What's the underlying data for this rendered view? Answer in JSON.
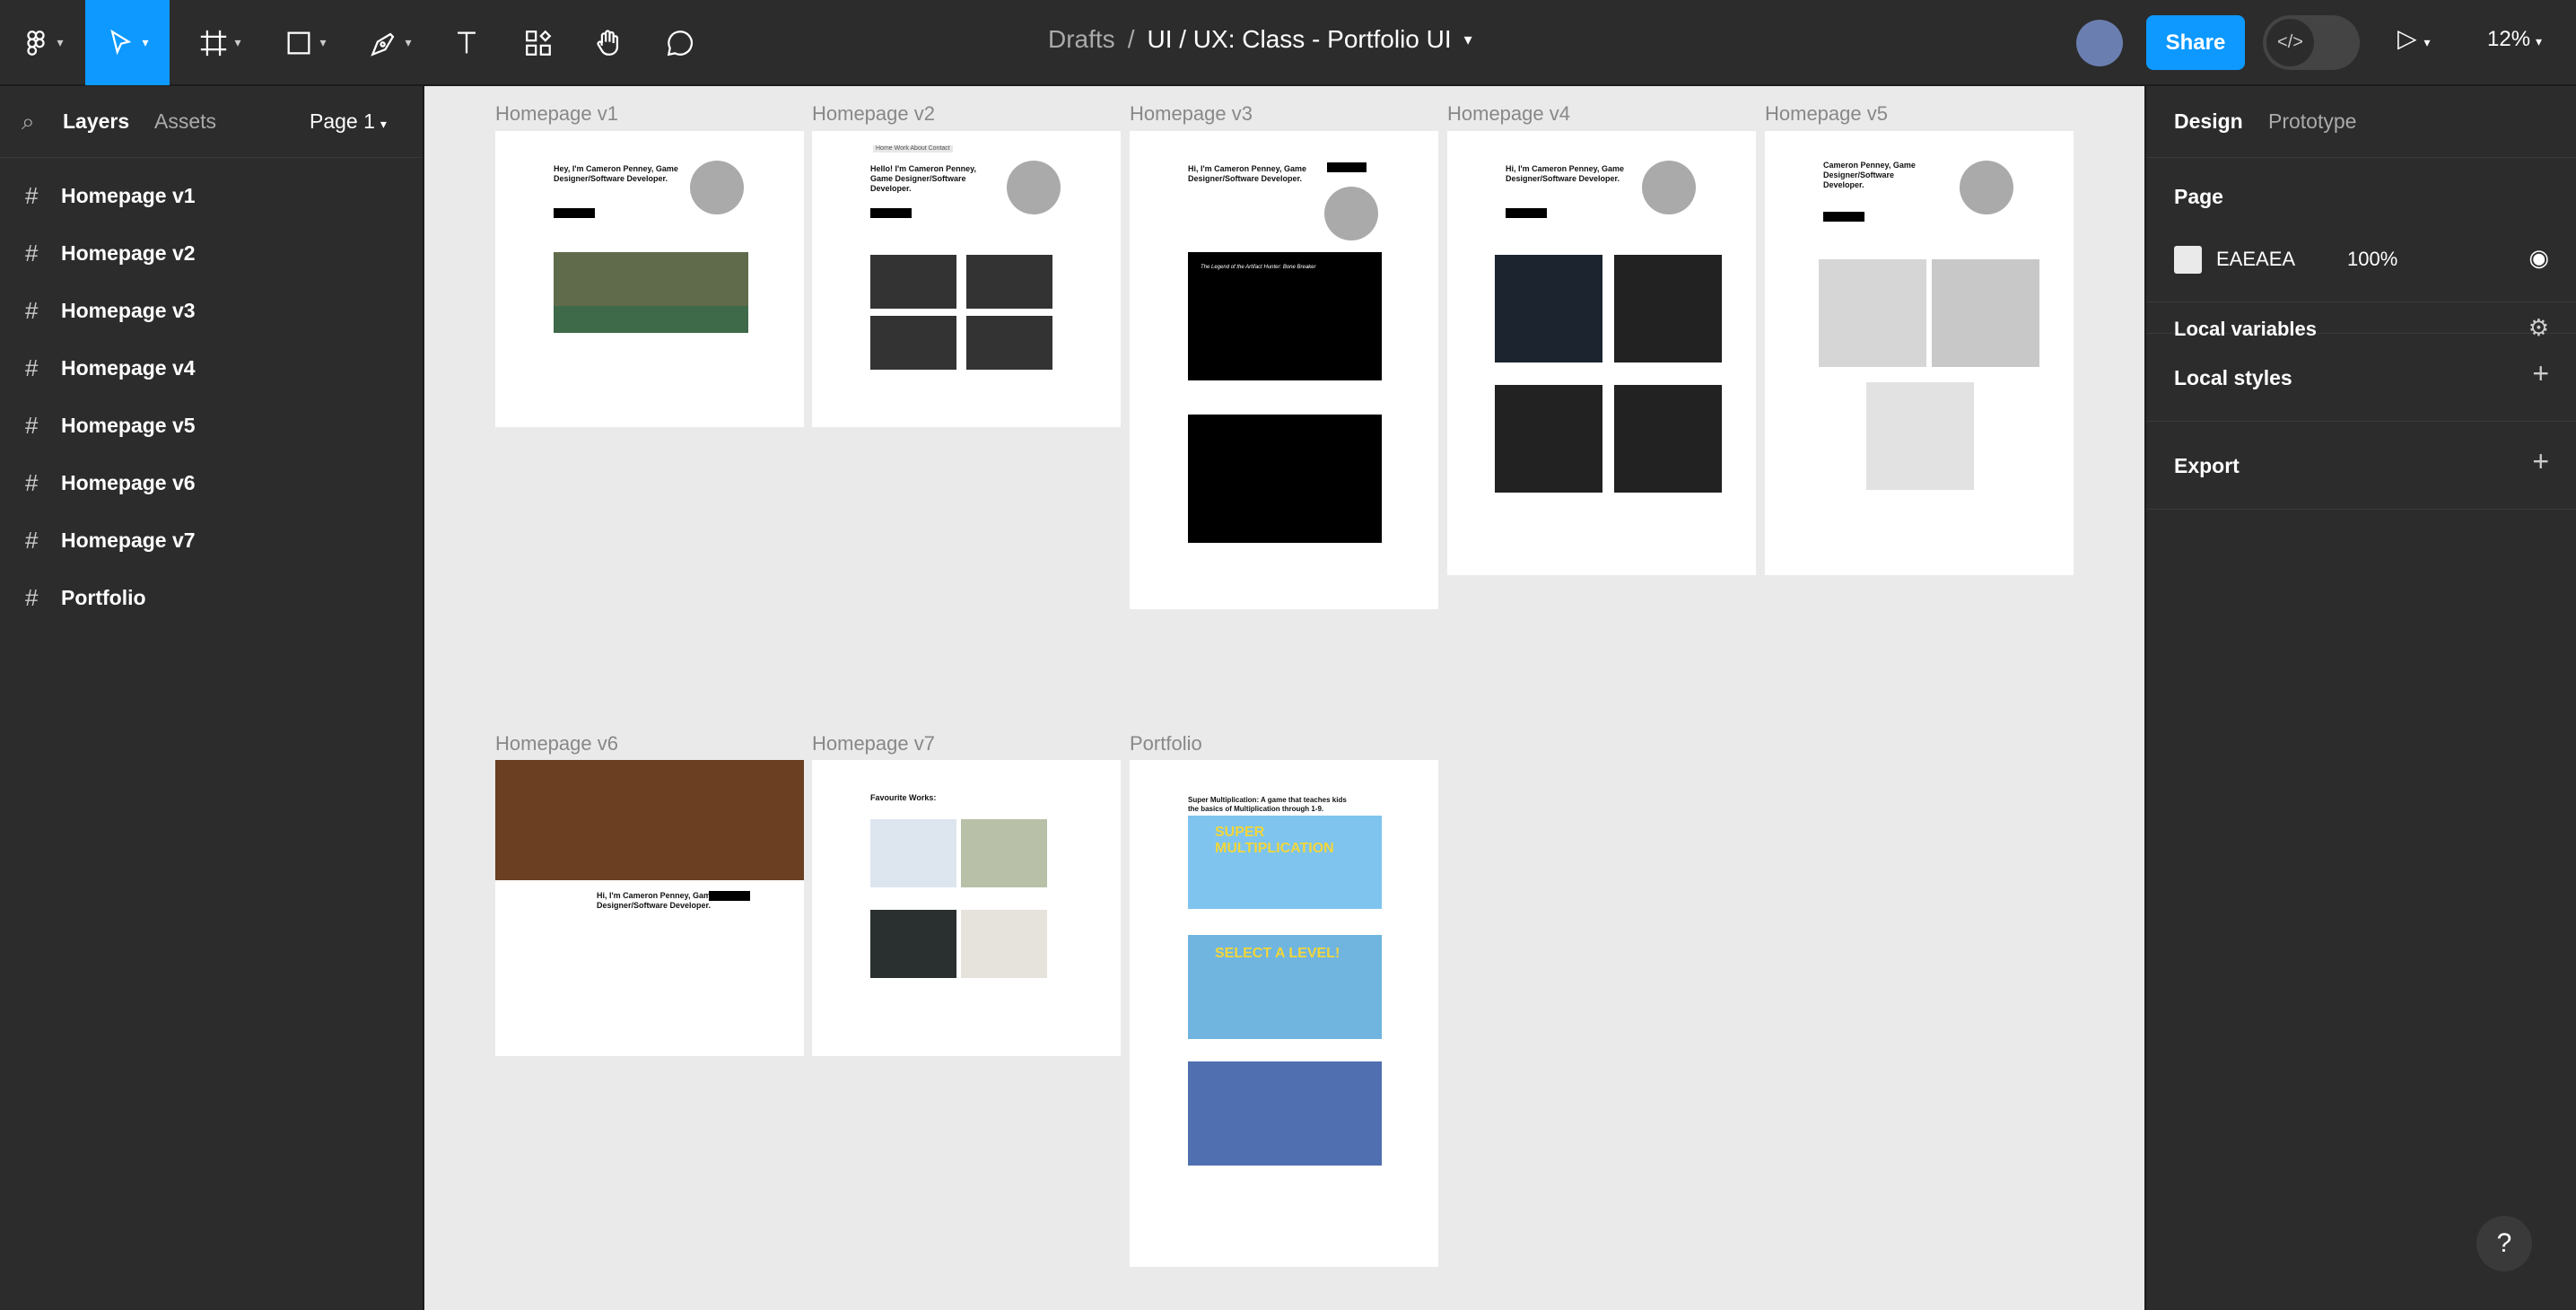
{
  "toolbar": {
    "tools": [
      {
        "name": "figma-menu-icon"
      },
      {
        "name": "move-tool-icon"
      },
      {
        "name": "frame-tool-icon"
      },
      {
        "name": "shape-tool-icon"
      },
      {
        "name": "pen-tool-icon"
      },
      {
        "name": "text-tool-icon"
      },
      {
        "name": "resources-tool-icon"
      },
      {
        "name": "hand-tool-icon"
      },
      {
        "name": "comment-tool-icon"
      }
    ],
    "breadcrumb_root": "Drafts",
    "breadcrumb_sep": "/",
    "file_name": "UI / UX: Class - Portfolio UI",
    "share_label": "Share",
    "zoom_label": "12%",
    "dev_mode_icon": "</>"
  },
  "left_panel": {
    "tabs": [
      "Layers",
      "Assets"
    ],
    "page_selector": "Page 1",
    "layers": [
      "Homepage v1",
      "Homepage v2",
      "Homepage v3",
      "Homepage v4",
      "Homepage v5",
      "Homepage v6",
      "Homepage v7",
      "Portfolio"
    ]
  },
  "canvas": {
    "background": "#EAEAEA",
    "frames": {
      "v1": {
        "label": "Homepage v1",
        "heading": "Hey, I'm Cameron Penney, Game Designer/Software Developer."
      },
      "v2": {
        "label": "Homepage v2",
        "nav": "Home  Work  About  Contact",
        "heading": "Hello! I'm Cameron Penney, Game Designer/Software Developer."
      },
      "v3": {
        "label": "Homepage v3",
        "heading": "Hi, I'm Cameron Penney, Game Designer/Software Developer.",
        "box_title": "The Legend of the Artifact Hunter: Bone Breaker"
      },
      "v4": {
        "label": "Homepage v4",
        "heading": "Hi, I'm Cameron Penney, Game Designer/Software Developer."
      },
      "v5": {
        "label": "Homepage v5",
        "heading": "Cameron Penney, Game Designer/Software Developer."
      },
      "v6": {
        "label": "Homepage v6",
        "heading": "Hi, I'm Cameron Penney, Game Designer/Software Developer."
      },
      "v7": {
        "label": "Homepage v7",
        "heading": "Favourite Works:"
      },
      "portfolio": {
        "label": "Portfolio",
        "heading": "Super Multiplication: A game that teaches kids the basics of Multiplication through 1-9.",
        "banner1": "SUPER MULTIPLICATION",
        "banner2": "SELECT A LEVEL!"
      }
    }
  },
  "right_panel": {
    "tabs": [
      "Design",
      "Prototype"
    ],
    "page_section": "Page",
    "page_color_hex": "EAEAEA",
    "page_opacity": "100%",
    "local_variables": "Local variables",
    "local_styles": "Local styles",
    "export": "Export"
  },
  "help_label": "?"
}
